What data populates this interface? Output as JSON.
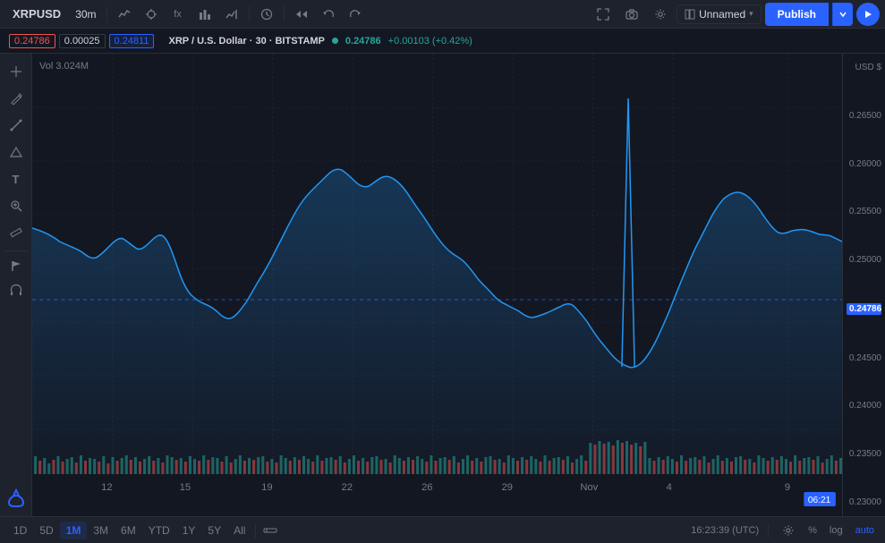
{
  "toolbar": {
    "symbol": "XRPUSD",
    "interval": "30m",
    "unnamed_label": "Unnamed",
    "publish_label": "Publish",
    "icons": {
      "line_chart": "∿",
      "crosshair": "⊕",
      "fx": "fx",
      "bar_chart": "⬛",
      "indicator": "⤴",
      "timer": "⏱",
      "rewind": "⏮",
      "undo": "↺",
      "redo": "↻",
      "fullscreen": "⛶",
      "camera": "📷",
      "settings": "⚙",
      "arrow_down": "▾",
      "arrow_right": "▶"
    }
  },
  "price_bar": {
    "title": "XRP / U.S. Dollar · 30 · BITSTAMP",
    "current": "0.24786",
    "change": "+0.00103",
    "change_pct": "(+0.42%)",
    "open_label": "0.24786",
    "spread_label": "0.00025",
    "bid_label": "0.24811",
    "usd_label": "USD $"
  },
  "chart": {
    "price_labels": [
      "0.26500",
      "0.26000",
      "0.25500",
      "0.25000",
      "0.24500",
      "0.24000",
      "0.23500",
      "0.23000"
    ],
    "current_price_label": "0.24786",
    "time_cursor": "06:21",
    "time_labels": [
      "12",
      "15",
      "19",
      "22",
      "26",
      "29",
      "Nov",
      "4",
      "9"
    ],
    "vol_label": "Vol 3.024M"
  },
  "timeframes": [
    {
      "label": "1D",
      "active": false
    },
    {
      "label": "5D",
      "active": false
    },
    {
      "label": "1M",
      "active": true
    },
    {
      "label": "3M",
      "active": false
    },
    {
      "label": "6M",
      "active": false
    },
    {
      "label": "YTD",
      "active": false
    },
    {
      "label": "1Y",
      "active": false
    },
    {
      "label": "5Y",
      "active": false
    },
    {
      "label": "All",
      "active": false
    }
  ],
  "bottom_bar": {
    "timestamp": "16:23:39 (UTC)",
    "percent_label": "%",
    "log_label": "log",
    "auto_label": "auto",
    "settings_icon": "⚙"
  },
  "left_tools": [
    "✛",
    "✎",
    "╱",
    "⬡",
    "T",
    "🔍",
    "📐",
    "📏",
    "⚑",
    "🧲"
  ]
}
